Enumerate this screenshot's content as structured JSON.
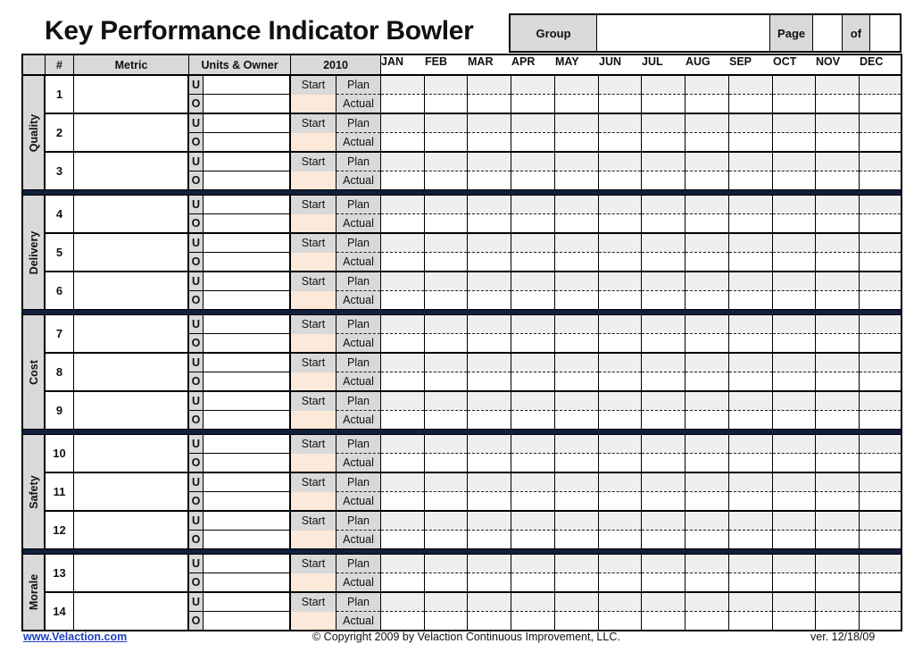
{
  "title": "Key Performance Indicator Bowler",
  "header_box": {
    "group_label": "Group",
    "group_value": "",
    "page_label": "Page",
    "page_value": "",
    "of_label": "of",
    "total_value": ""
  },
  "columns": {
    "section": "",
    "number": "#",
    "metric": "Metric",
    "units_owner": "Units & Owner",
    "year": "2010",
    "months": [
      "JAN",
      "FEB",
      "MAR",
      "APR",
      "MAY",
      "JUN",
      "JUL",
      "AUG",
      "SEP",
      "OCT",
      "NOV",
      "DEC"
    ]
  },
  "labels": {
    "units_letter": "U",
    "owner_letter": "O",
    "start": "Start",
    "plan": "Plan",
    "actual": "Actual"
  },
  "sections": [
    {
      "name": "Quality",
      "kpis": [
        {
          "number": "1"
        },
        {
          "number": "2"
        },
        {
          "number": "3"
        }
      ]
    },
    {
      "name": "Delivery",
      "kpis": [
        {
          "number": "4"
        },
        {
          "number": "5"
        },
        {
          "number": "6"
        }
      ]
    },
    {
      "name": "Cost",
      "kpis": [
        {
          "number": "7"
        },
        {
          "number": "8"
        },
        {
          "number": "9"
        }
      ]
    },
    {
      "name": "Safety",
      "kpis": [
        {
          "number": "10"
        },
        {
          "number": "11"
        },
        {
          "number": "12"
        }
      ]
    },
    {
      "name": "Morale",
      "kpis": [
        {
          "number": "13"
        },
        {
          "number": "14"
        }
      ]
    }
  ],
  "colors": {
    "header_gray": "#d9d9d9",
    "start_value_peach": "#fde9d9",
    "plan_row_gray": "#efefef",
    "section_divider_navy": "#0f1f3d",
    "link_blue": "#1f3fbf"
  },
  "footer": {
    "link": "www.Velaction.com",
    "copyright": "© Copyright 2009 by Velaction Continuous Improvement, LLC.",
    "version": "ver. 12/18/09"
  }
}
